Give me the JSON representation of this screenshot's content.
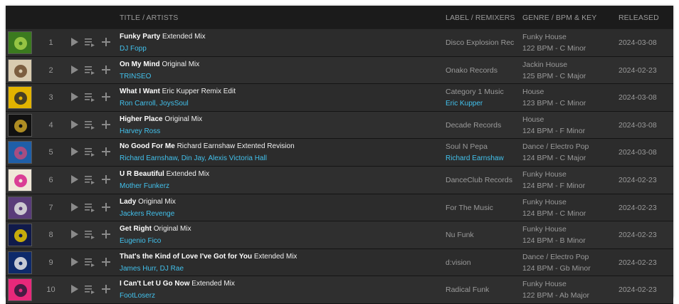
{
  "headers": {
    "title": "TITLE / ARTISTS",
    "label": "LABEL / REMIXERS",
    "genre": "GENRE / BPM & KEY",
    "released": "RELEASED"
  },
  "tracks": [
    {
      "num": "1",
      "title": "Funky Party",
      "mix": "Extended Mix",
      "artists": "DJ Fopp",
      "label": "Disco Explosion Records",
      "remixers": "",
      "genre": "Funky House",
      "bpm_key": "122 BPM - C Minor",
      "released": "2024-03-08",
      "art_color": "#3b7a1f",
      "art_accent": "#a6d14a"
    },
    {
      "num": "2",
      "title": "On My Mind",
      "mix": "Original Mix",
      "artists": "TRINSEO",
      "label": "Onako Records",
      "remixers": "",
      "genre": "Jackin House",
      "bpm_key": "125 BPM - C Major",
      "released": "2024-02-23",
      "art_color": "#d9cbb0",
      "art_accent": "#6b4a2b"
    },
    {
      "num": "3",
      "title": "What I Want",
      "mix": "Eric Kupper Remix Edit",
      "artists": "Ron Carroll, JoysSoul",
      "label": "Category 1 Music",
      "remixers": "Eric Kupper",
      "genre": "House",
      "bpm_key": "123 BPM - C Minor",
      "released": "2024-03-08",
      "art_color": "#e2b300",
      "art_accent": "#2a2a2a"
    },
    {
      "num": "4",
      "title": "Higher Place",
      "mix": "Original Mix",
      "artists": "Harvey Ross",
      "label": "Decade Records",
      "remixers": "",
      "genre": "House",
      "bpm_key": "124 BPM - F Minor",
      "released": "2024-03-08",
      "art_color": "#111111",
      "art_accent": "#c9a227"
    },
    {
      "num": "5",
      "title": "No Good For Me",
      "mix": "Richard Earnshaw Extented Revision",
      "artists": "Richard Earnshaw, Din Jay, Alexis Victoria Hall",
      "label": "Soul N Pepa",
      "remixers": "Richard Earnshaw",
      "genre": "Dance / Electro Pop",
      "bpm_key": "124 BPM - C Major",
      "released": "2024-03-08",
      "art_color": "#1f5fa8",
      "art_accent": "#c04a7a"
    },
    {
      "num": "6",
      "title": "U R Beautiful",
      "mix": "Extended Mix",
      "artists": "Mother Funkerz",
      "label": "DanceClub Records",
      "remixers": "",
      "genre": "Funky House",
      "bpm_key": "124 BPM - F Minor",
      "released": "2024-02-23",
      "art_color": "#f0e7d8",
      "art_accent": "#d6208a"
    },
    {
      "num": "7",
      "title": "Lady",
      "mix": "Original Mix",
      "artists": "Jackers Revenge",
      "label": "For The Music",
      "remixers": "",
      "genre": "Funky House",
      "bpm_key": "124 BPM - C Minor",
      "released": "2024-02-23",
      "art_color": "#5a3c7a",
      "art_accent": "#e0e0e0"
    },
    {
      "num": "8",
      "title": "Get Right",
      "mix": "Original Mix",
      "artists": "Eugenio Fico",
      "label": "Nu Funk",
      "remixers": "",
      "genre": "Funky House",
      "bpm_key": "124 BPM - B Minor",
      "released": "2024-02-23",
      "art_color": "#101a4a",
      "art_accent": "#e6c400"
    },
    {
      "num": "9",
      "title": "That's the Kind of Love I've Got for You",
      "mix": "Extended Mix",
      "artists": "James Hurr, DJ Rae",
      "label": "d:vision",
      "remixers": "",
      "genre": "Dance / Electro Pop",
      "bpm_key": "124 BPM - Gb Minor",
      "released": "2024-02-23",
      "art_color": "#0e2a6b",
      "art_accent": "#e6e6e6"
    },
    {
      "num": "10",
      "title": "I Can't Let U Go Now",
      "mix": "Extended Mix",
      "artists": "FootLoserz",
      "label": "Radical Funk",
      "remixers": "",
      "genre": "Funky House",
      "bpm_key": "122 BPM - Ab Major",
      "released": "2024-02-23",
      "art_color": "#e8287a",
      "art_accent": "#2a1a3a"
    }
  ]
}
